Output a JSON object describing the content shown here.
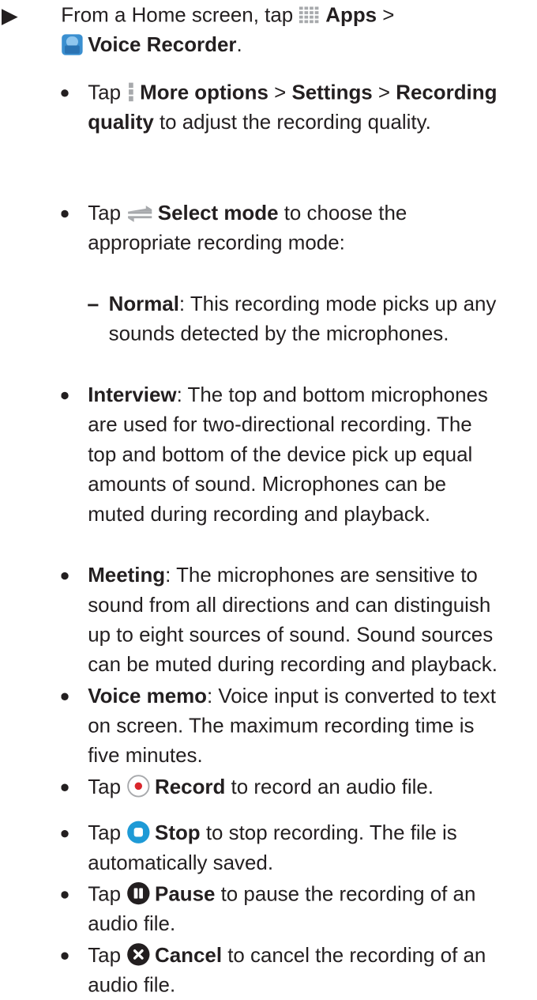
{
  "step": {
    "intro": "From a Home screen, tap",
    "apps_label": "Apps",
    "sep": ">",
    "voice_recorder_label": "Voice Recorder",
    "end": "."
  },
  "bullets": {
    "settings": {
      "tap": "Tap",
      "more_options": "More options",
      "sep1": ">",
      "settings": "Settings",
      "sep2": ">",
      "recording_quality": "Recording quality",
      "rest": "to adjust the recording quality."
    },
    "select_mode": {
      "tap": "Tap",
      "label": "Select mode",
      "rest": "to choose the appropriate recording mode:"
    },
    "normal": {
      "label": "Normal",
      "rest": ": This recording mode picks up any sounds detected by the microphones."
    },
    "interview": {
      "label": "Interview",
      "rest": ": The top and bottom microphones are used for two-directional recording. The top and bottom of the device pick up equal amounts of sound. Microphones can be muted during recording and playback."
    },
    "meeting": {
      "label": "Meeting",
      "rest": ": The microphones are sensitive to sound from all directions and can distinguish up to eight sources of sound. Sound sources can be muted during recording and playback."
    },
    "voice_memo": {
      "label": "Voice memo",
      "rest": ": Voice input is converted to text on screen. The maximum recording time is five minutes."
    },
    "record": {
      "tap": "Tap",
      "label": "Record",
      "rest": "to record an audio file."
    },
    "stop": {
      "tap": "Tap",
      "label": "Stop",
      "rest": "to stop recording. The file is automatically saved."
    },
    "pause": {
      "tap": "Tap",
      "label": "Pause",
      "rest": "to pause the recording of an audio file."
    },
    "cancel": {
      "tap": "Tap",
      "label": "Cancel",
      "rest": "to cancel the recording of an audio file."
    }
  },
  "icons": {
    "apps": "apps-grid-icon",
    "voice_recorder": "voice-recorder-app-icon",
    "more_options": "more-options-icon",
    "select_mode": "select-mode-arrows-icon",
    "record": "record-icon",
    "stop": "stop-icon",
    "pause": "pause-icon",
    "cancel": "cancel-icon"
  },
  "colors": {
    "text": "#231f20",
    "record_dot": "#d9262c",
    "stop_blue": "#1e9ad6",
    "recorder_blue": "#3a8fd0"
  }
}
